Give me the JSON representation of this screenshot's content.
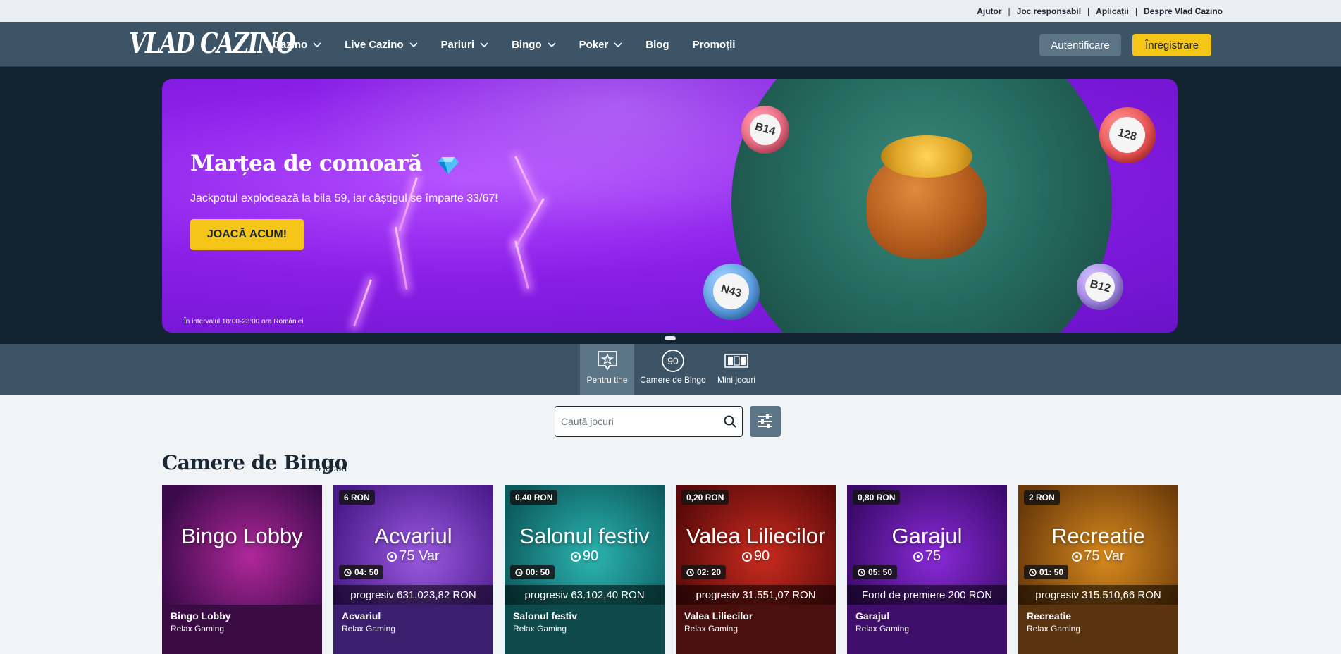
{
  "topbar": {
    "links": [
      "Ajutor",
      "Joc responsabil",
      "Aplicații",
      "Despre Vlad Cazino"
    ],
    "separator": "|"
  },
  "nav": {
    "logo": "VLAD CAZINO",
    "items": [
      {
        "label": "Cazino",
        "dropdown": true
      },
      {
        "label": "Live Cazino",
        "dropdown": true
      },
      {
        "label": "Pariuri",
        "dropdown": true
      },
      {
        "label": "Bingo",
        "dropdown": true
      },
      {
        "label": "Poker",
        "dropdown": true
      },
      {
        "label": "Blog",
        "dropdown": false
      },
      {
        "label": "Promoții",
        "dropdown": false
      }
    ],
    "login_label": "Autentificare",
    "register_label": "Înregistrare"
  },
  "hero": {
    "title": "Marțea de comoară",
    "subtitle": "Jackpotul explodează la bila 59, iar câștigul se împarte 33/67!",
    "cta": "JOACĂ ACUM!",
    "note": "În intervalul 18:00-23:00 ora României",
    "balls": [
      "B14",
      "128",
      "N43",
      "B12"
    ]
  },
  "categories": [
    {
      "label": "Pentru tine",
      "icon": "star-bubble-icon",
      "active": true
    },
    {
      "label": "Camere de Bingo",
      "icon": "bingo-90-icon",
      "active": false
    },
    {
      "label": "Mini jocuri",
      "icon": "mini-games-icon",
      "active": false
    }
  ],
  "search": {
    "placeholder": "Caută jocuri"
  },
  "section": {
    "title": "Camere de Bingo",
    "count": "8 jocuri"
  },
  "cards": [
    {
      "name": "Bingo Lobby",
      "provider": "Relax Gaming",
      "art_title": "Bingo Lobby",
      "art_sub": "",
      "badge": "",
      "timer": "",
      "progress": "",
      "bg1": "#3a0a4a",
      "bg2": "#b0279a",
      "info": "#3b0b44"
    },
    {
      "name": "Acvariul",
      "provider": "Relax Gaming",
      "art_title": "Acvariul",
      "art_sub": "75 Var",
      "badge": "6 RON",
      "timer": "04: 50",
      "progress": "progresiv 631.023,82 RON",
      "bg1": "#4a1a8a",
      "bg2": "#9a5ae0",
      "info": "#3a1f6e"
    },
    {
      "name": "Salonul festiv",
      "provider": "Relax Gaming",
      "art_title": "Salonul festiv",
      "art_sub": "90",
      "badge": "0,40 RON",
      "timer": "00: 50",
      "progress": "progresiv 63.102,40 RON",
      "bg1": "#0d5a5e",
      "bg2": "#2bb5b0",
      "info": "#0e4a4c"
    },
    {
      "name": "Valea Liliecilor",
      "provider": "Relax Gaming",
      "art_title": "Valea Liliecilor",
      "art_sub": "90",
      "badge": "0,20 RON",
      "timer": "02: 20",
      "progress": "progresiv 31.551,07 RON",
      "bg1": "#5a0a0a",
      "bg2": "#c92b1e",
      "info": "#4a0f0f"
    },
    {
      "name": "Garajul",
      "provider": "Relax Gaming",
      "art_title": "Garajul",
      "art_sub": "75",
      "badge": "0,80 RON",
      "timer": "05: 50",
      "progress": "Fond de premiere 200 RON",
      "bg1": "#3a0a6a",
      "bg2": "#8a2ad8",
      "info": "#3e0e6a"
    },
    {
      "name": "Recreatie",
      "provider": "Relax Gaming",
      "art_title": "Recreatie",
      "art_sub": "75 Var",
      "badge": "2 RON",
      "timer": "01: 50",
      "progress": "progresiv 315.510,66 RON",
      "bg1": "#6a3a0a",
      "bg2": "#d88a1e",
      "info": "#5a3410"
    }
  ],
  "colors": {
    "accent_yellow": "#f5c518",
    "nav_bg": "#3d5466",
    "hero_bg": "#122432"
  }
}
